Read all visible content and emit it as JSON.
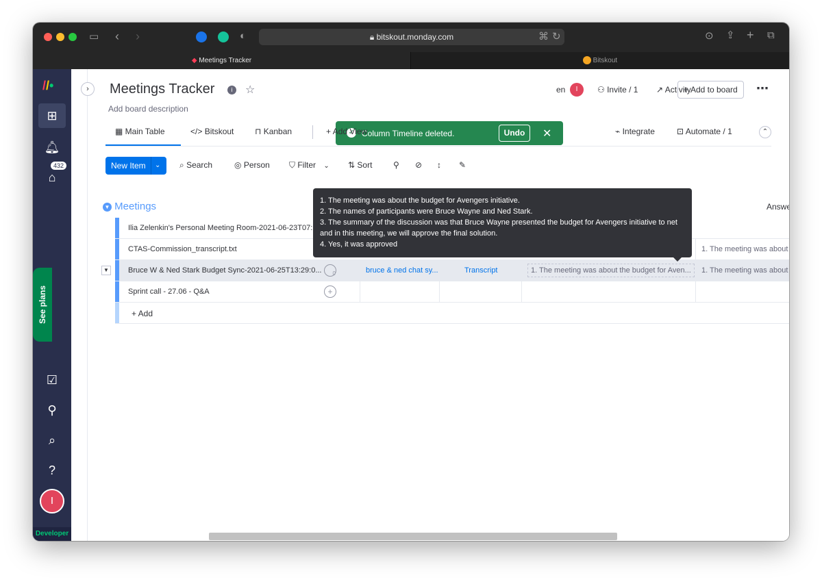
{
  "browser": {
    "url": "bitskout.monday.com",
    "tabs": [
      {
        "label": "Meetings Tracker",
        "active": true
      },
      {
        "label": "Bitskout",
        "active": false
      }
    ]
  },
  "sidebar": {
    "inbox_count": "432",
    "see_plans": "See plans",
    "avatar_initial": "I",
    "developer": "Developer"
  },
  "board": {
    "title": "Meetings Tracker",
    "description": "Add board description",
    "header_partial": "en",
    "header_avatar": "I",
    "invite": "Invite / 1",
    "activity": "Activity",
    "add_to_board": "Add to board"
  },
  "views": [
    {
      "label": "Main Table"
    },
    {
      "label": "Bitskout"
    },
    {
      "label": "Kanban"
    },
    {
      "label": "Add View"
    }
  ],
  "view_actions": {
    "integrate": "Integrate",
    "automate": "Automate / 1"
  },
  "toolbar": {
    "new_item": "New Item",
    "search": "Search",
    "person": "Person",
    "filter": "Filter",
    "sort": "Sort"
  },
  "toast": {
    "message": "Column Timeline deleted.",
    "undo": "Undo"
  },
  "table": {
    "group_name": "Meetings",
    "partial_column": "Answe",
    "add_label": "+ Add",
    "rows": [
      {
        "name": "Ilia Zelenkin's Personal Meeting Room-2021-06-23T07:..."
      },
      {
        "name": "CTAS-Commission_transcript.txt",
        "answer": "1. The meeting was about"
      },
      {
        "name": "Bruce W & Ned Stark Budget Sync-2021-06-25T13:29:0...",
        "updates": "0",
        "file": "bruce & ned chat sy...",
        "link": "Transcript",
        "summary": "1. The meeting was about the budget for Aven...",
        "answer": "1. The meeting was about"
      },
      {
        "name": "Sprint call - 27.06 - Q&A"
      }
    ]
  },
  "tooltip": {
    "lines": [
      "1. The meeting was about the budget for Avengers initiative.",
      "2. The names of participants were Bruce Wayne and Ned Stark.",
      "3. The summary of the discussion was that Bruce Wayne presented the budget for Avengers initiative to net and in this meeting, we will approve the final solution.",
      "4. Yes, it was approved"
    ]
  },
  "colors": {
    "primary": "#0073ea",
    "sidebar": "#292f4c",
    "toast": "#258750",
    "group": "#579bfc",
    "danger": "#e2445c"
  }
}
